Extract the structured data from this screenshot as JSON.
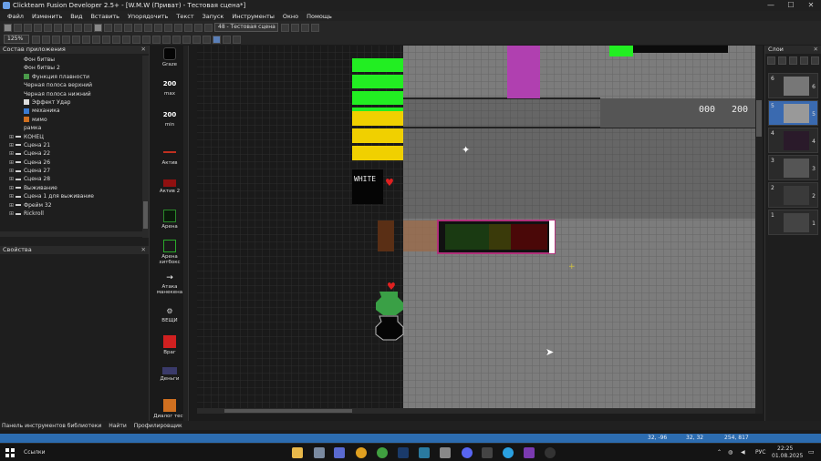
{
  "window": {
    "title": "Clickteam Fusion Developer 2.5+ - [W.M.W (Приват) - Тестовая сцена*]",
    "minimize": "—",
    "maximize": "☐",
    "close": "✕"
  },
  "menu": [
    "Файл",
    "Изменить",
    "Вид",
    "Вставить",
    "Упорядочить",
    "Текст",
    "Запуск",
    "Инструменты",
    "Окно",
    "Помощь"
  ],
  "toolbar": {
    "zoom": "125%",
    "frame_select": "48 - Тестовая сцена"
  },
  "workspace": {
    "header": "Состав приложения",
    "items": [
      {
        "label": "Фон битвы",
        "indent": 3,
        "icon": "none"
      },
      {
        "label": "Фон битвы 2",
        "indent": 3,
        "icon": "none"
      },
      {
        "label": "Функция плавности",
        "indent": 3,
        "icon": "green"
      },
      {
        "label": "Черная полоса верхний",
        "indent": 3,
        "icon": "none"
      },
      {
        "label": "Черная полоса нижний",
        "indent": 3,
        "icon": "none"
      },
      {
        "label": "Эффект Удар",
        "indent": 3,
        "icon": "star"
      },
      {
        "label": "механика",
        "indent": 3,
        "icon": "blue"
      },
      {
        "label": "мимо",
        "indent": 3,
        "icon": "orange"
      },
      {
        "label": "рамка",
        "indent": 3,
        "icon": "none"
      },
      {
        "label": "КОНЕЦ",
        "indent": 1,
        "icon": "frame"
      },
      {
        "label": "Сцена 21",
        "indent": 1,
        "icon": "frame"
      },
      {
        "label": "Сцена 22",
        "indent": 1,
        "icon": "frame"
      },
      {
        "label": "Сцена 26",
        "indent": 1,
        "icon": "frame"
      },
      {
        "label": "Сцена 27",
        "indent": 1,
        "icon": "frame"
      },
      {
        "label": "Сцена 28",
        "indent": 1,
        "icon": "frame"
      },
      {
        "label": "Выживание",
        "indent": 1,
        "icon": "frame"
      },
      {
        "label": "Сцена 1 для выживание",
        "indent": 1,
        "icon": "frame"
      },
      {
        "label": "Фрейм 32",
        "indent": 1,
        "icon": "frame"
      },
      {
        "label": "Rickroll",
        "indent": 1,
        "icon": "frame"
      }
    ]
  },
  "properties": {
    "header": "Свойства"
  },
  "objects": [
    {
      "label": "Graze",
      "icon": "graze"
    },
    {
      "label": "max",
      "icon": "text200"
    },
    {
      "label": "min",
      "icon": "text200"
    },
    {
      "label": "Актив",
      "icon": "line-red"
    },
    {
      "label": "Актив 2",
      "icon": "red-block"
    },
    {
      "label": "Арена",
      "icon": "arena"
    },
    {
      "label": "Арена хитбокс",
      "icon": "arena-outline"
    },
    {
      "label": "Атака манекена",
      "icon": "arrow"
    },
    {
      "label": "ВЕЩИ",
      "icon": "item"
    },
    {
      "label": "Враг",
      "icon": "enemy"
    },
    {
      "label": "Деньги",
      "icon": "money"
    },
    {
      "label": "Диалог тест",
      "icon": "dialog"
    }
  ],
  "object_text": {
    "value_200": "200",
    "white": "WHITE"
  },
  "scene_text": {
    "counter_a": "000",
    "counter_b": "200"
  },
  "layers": {
    "header": "Слои",
    "items": [
      {
        "num": "6",
        "num2": "6",
        "thumb": "#777"
      },
      {
        "num": "5",
        "num2": "5",
        "thumb": "#999",
        "active": true
      },
      {
        "num": "4",
        "num2": "4",
        "thumb": "#2a1a2a"
      },
      {
        "num": "3",
        "num2": "3",
        "thumb": "#555"
      },
      {
        "num": "2",
        "num2": "2",
        "thumb": "#3a3a3a"
      },
      {
        "num": "1",
        "num2": "1",
        "thumb": "#444"
      }
    ]
  },
  "bottom_tabs": [
    "Панель инструментов библиотеки",
    "Найти",
    "Профилировщик"
  ],
  "status": {
    "coords1": "32, -96",
    "coords2": "32, 32",
    "coords3": "254, 817"
  },
  "taskbar": {
    "search": "Ссылки",
    "lang": "РУС",
    "time": "22:25",
    "date": "01.08.2025"
  },
  "colors": {
    "status_blue": "#2c6cb0",
    "grid_dark": "#1c1c1c",
    "grid_gray": "#8a8a8a",
    "accent_green": "#22ee22",
    "accent_yellow": "#f0d000",
    "accent_magenta": "#c02cc0"
  }
}
